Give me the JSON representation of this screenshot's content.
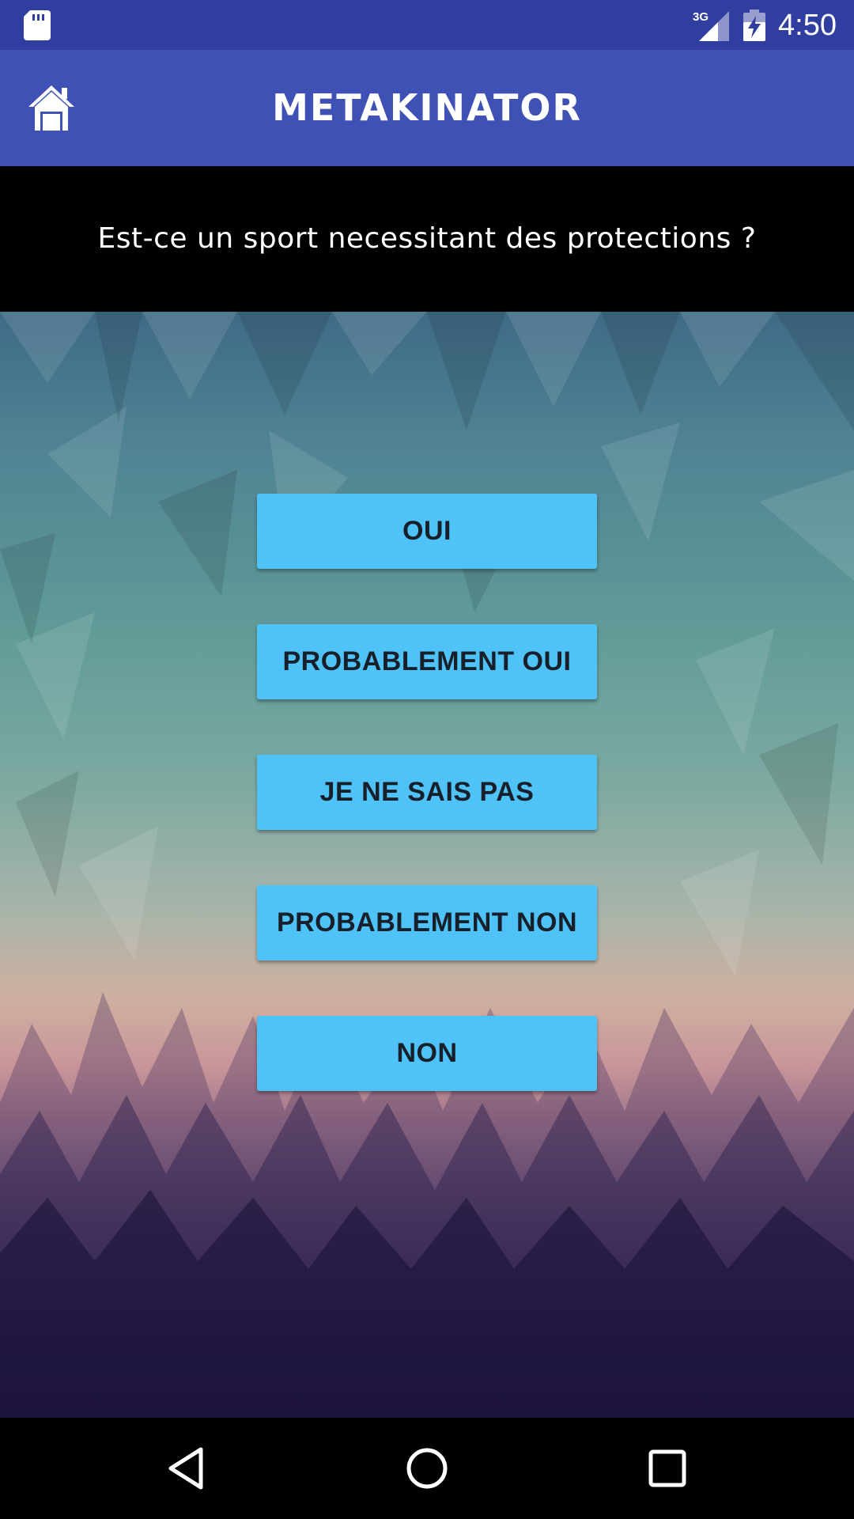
{
  "status_bar": {
    "time": "4:50",
    "network": "3G",
    "icons": [
      "sd-card-icon",
      "signal-icon",
      "battery-charging-icon"
    ]
  },
  "app_bar": {
    "title": "METAKINATOR",
    "home_icon": "home-icon",
    "color": "#3F51B5"
  },
  "question": {
    "text": "Est-ce un sport necessitant des protections ?"
  },
  "answers": [
    {
      "label": "OUI"
    },
    {
      "label": "PROBABLEMENT OUI"
    },
    {
      "label": "JE NE SAIS PAS"
    },
    {
      "label": "PROBABLEMENT NON"
    },
    {
      "label": "NON"
    }
  ],
  "colors": {
    "status_bar": "#303F9F",
    "button": "#4FC3F7",
    "button_text": "#17202A"
  },
  "nav_bar": {
    "icons": [
      "back-icon",
      "home-circle-icon",
      "recents-icon"
    ]
  }
}
